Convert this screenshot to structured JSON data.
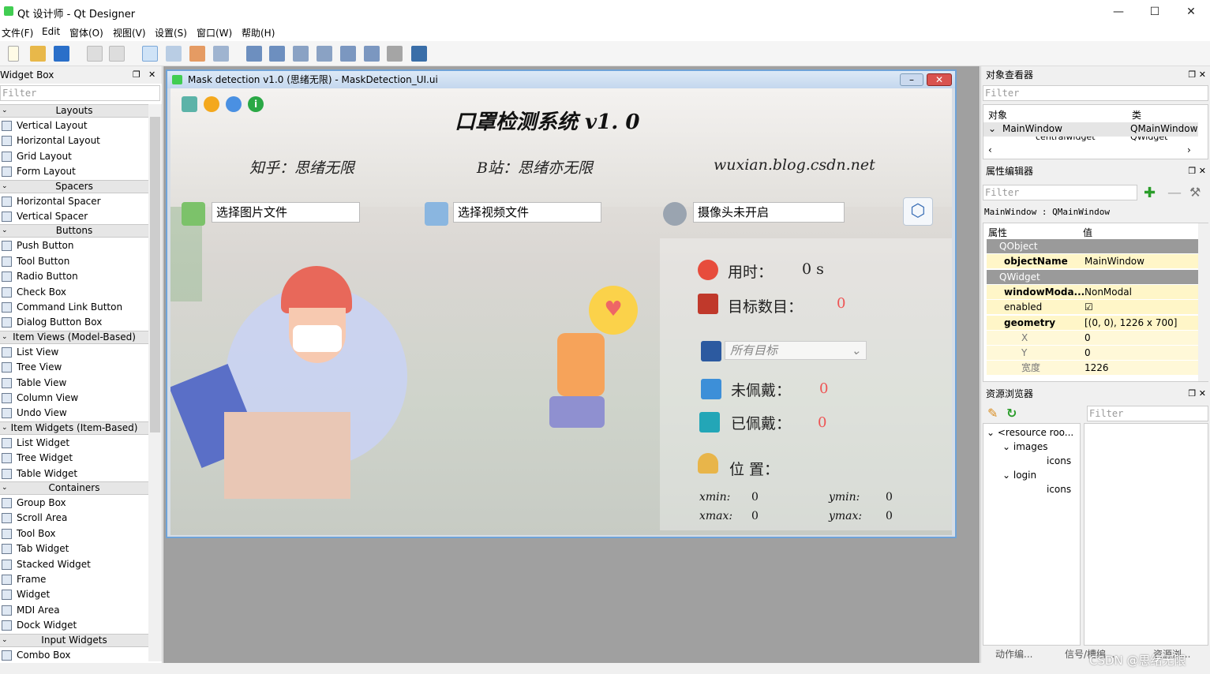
{
  "window": {
    "title": "Qt 设计师 - Qt Designer",
    "min": "—",
    "max": "☐",
    "close": "✕"
  },
  "menu": [
    "文件(F)",
    "Edit",
    "窗体(O)",
    "视图(V)",
    "设置(S)",
    "窗口(W)",
    "帮助(H)"
  ],
  "widget_box": {
    "title": "Widget Box",
    "filter": "Filter",
    "categories": [
      {
        "name": "Layouts",
        "items": [
          "Vertical Layout",
          "Horizontal Layout",
          "Grid Layout",
          "Form Layout"
        ]
      },
      {
        "name": "Spacers",
        "items": [
          "Horizontal Spacer",
          "Vertical Spacer"
        ]
      },
      {
        "name": "Buttons",
        "items": [
          "Push Button",
          "Tool Button",
          "Radio Button",
          "Check Box",
          "Command Link Button",
          "Dialog Button Box"
        ]
      },
      {
        "name": "Item Views (Model-Based)",
        "items": [
          "List View",
          "Tree View",
          "Table View",
          "Column View",
          "Undo View"
        ]
      },
      {
        "name": "Item Widgets (Item-Based)",
        "items": [
          "List Widget",
          "Tree Widget",
          "Table Widget"
        ]
      },
      {
        "name": "Containers",
        "items": [
          "Group Box",
          "Scroll Area",
          "Tool Box",
          "Tab Widget",
          "Stacked Widget",
          "Frame",
          "Widget",
          "MDI Area",
          "Dock Widget"
        ]
      },
      {
        "name": "Input Widgets",
        "items": [
          "Combo Box"
        ]
      }
    ]
  },
  "form": {
    "title": "Mask detection v1.0  (思绪无限)  - MaskDetection_UI.ui",
    "heading": "口罩检测系统  v1. 0",
    "zhihu": "知乎：思绪无限",
    "bili": "B站：思绪亦无限",
    "blog": "wuxian.blog.csdn.net",
    "btn_image": "选择图片文件",
    "btn_video": "选择视频文件",
    "btn_camera": "摄像头未开启",
    "time_label": "用时：",
    "time_value": "0 s",
    "count_label": "目标数目：",
    "count_value": "0",
    "target_select": "所有目标",
    "unmasked_label": "未佩戴：",
    "unmasked_value": "0",
    "masked_label": "已佩戴：",
    "masked_value": "0",
    "position_label": "位  置：",
    "xmin_label": "xmin:",
    "xmin": "0",
    "ymin_label": "ymin:",
    "ymin": "0",
    "xmax_label": "xmax:",
    "xmax": "0",
    "ymax_label": "ymax:",
    "ymax": "0"
  },
  "object_inspector": {
    "title": "对象查看器",
    "filter": "Filter",
    "col_object": "对象",
    "col_class": "类",
    "rows": [
      {
        "obj": "MainWindow",
        "cls": "QMainWindow"
      },
      {
        "obj": "centralwidget",
        "cls": "QWidget"
      }
    ]
  },
  "property_editor": {
    "title": "属性编辑器",
    "filter": "Filter",
    "context": "MainWindow : QMainWindow",
    "col_prop": "属性",
    "col_val": "值",
    "rows": [
      {
        "k": "QObject",
        "v": "",
        "type": "group"
      },
      {
        "k": "objectName",
        "v": "MainWindow",
        "type": "bold"
      },
      {
        "k": "QWidget",
        "v": "",
        "type": "group"
      },
      {
        "k": "windowModa...",
        "v": "NonModal",
        "type": "bold"
      },
      {
        "k": "enabled",
        "v": "☑",
        "type": "normal"
      },
      {
        "k": "geometry",
        "v": "[(0, 0), 1226 x 700]",
        "type": "bold"
      },
      {
        "k": "X",
        "v": "0",
        "type": "sub"
      },
      {
        "k": "Y",
        "v": "0",
        "type": "sub"
      },
      {
        "k": "宽度",
        "v": "1226",
        "type": "sub"
      }
    ]
  },
  "resource_browser": {
    "title": "资源浏览器",
    "filter": "Filter",
    "tree": [
      {
        "label": "<resource roo...",
        "indent": 0
      },
      {
        "label": "images",
        "indent": 1
      },
      {
        "label": "icons",
        "indent": 2
      },
      {
        "label": "login",
        "indent": 1
      },
      {
        "label": "icons",
        "indent": 2
      }
    ]
  },
  "bottom_tabs": [
    "动作编...",
    "信号/槽编...",
    "资源浏..."
  ],
  "watermark": "CSDN @思绪无限"
}
